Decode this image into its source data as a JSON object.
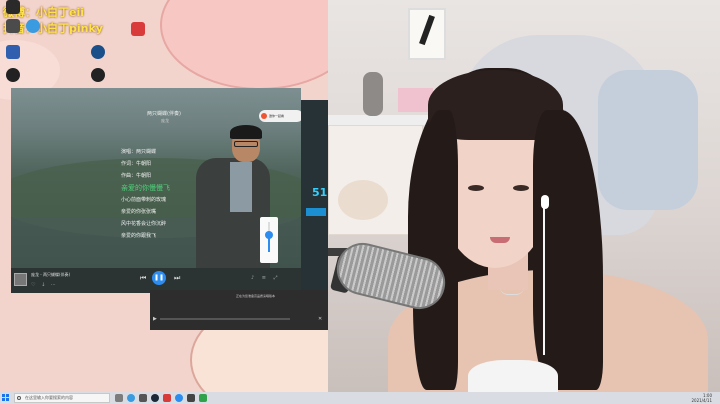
{
  "stream": {
    "weibo": "微博：小白丁eii",
    "douyin": "抖音：小白丁pinky"
  },
  "desktop": {
    "icons": [
      {
        "label": "",
        "icon": "app-icon",
        "color": "#4b4b4b"
      },
      {
        "label": "",
        "icon": "browser-icon",
        "color": "#3a9be0"
      },
      {
        "label": "",
        "icon": "app-icon",
        "color": "#2f5fae"
      },
      {
        "label": "",
        "icon": "recorder-icon",
        "color": "#d93a3a"
      },
      {
        "label": "",
        "icon": "app-icon",
        "color": "#222222"
      },
      {
        "label": "",
        "icon": "app-icon",
        "color": "#1b4f8a"
      },
      {
        "label": "",
        "icon": "app-icon",
        "color": "#222222"
      },
      {
        "label": "",
        "icon": "app-icon",
        "color": "#2a2a2a"
      }
    ]
  },
  "player": {
    "song_title": "两只蝴蝶(伴奏)",
    "artist_sub": "庞龙",
    "lyrics": [
      {
        "text": "演唱：两只蝴蝶",
        "active": false
      },
      {
        "text": "作词：牛朝阳",
        "active": false
      },
      {
        "text": "作曲：牛朝阳",
        "active": false
      },
      {
        "text": "亲爱的你慢慢飞",
        "active": true
      },
      {
        "text": "小心前面带刺的玫瑰",
        "active": false
      },
      {
        "text": "亲爱的你张张嘴",
        "active": false
      },
      {
        "text": "风中花香会让你沉醉",
        "active": false
      },
      {
        "text": "亲爱的你跟我飞",
        "active": false
      }
    ],
    "badge": "邀你一起看",
    "now_playing": "庞龙 - 两只蝴蝶(伴奏)",
    "volume_level": 0.55,
    "side_number": "51",
    "dialog_text": "正在为您准备高品质演唱版本",
    "accent": "#2d8cf0",
    "lyric_active_color": "#4fd07a"
  },
  "taskbar": {
    "search_placeholder": "在这里输入你要搜索的内容",
    "clock_time": "1:00",
    "clock_date": "2021/4/11",
    "apps": [
      "file-explorer-icon",
      "browser-icon",
      "store-icon",
      "steam-icon",
      "app-icon",
      "app-icon",
      "app-icon",
      "app-icon"
    ]
  }
}
